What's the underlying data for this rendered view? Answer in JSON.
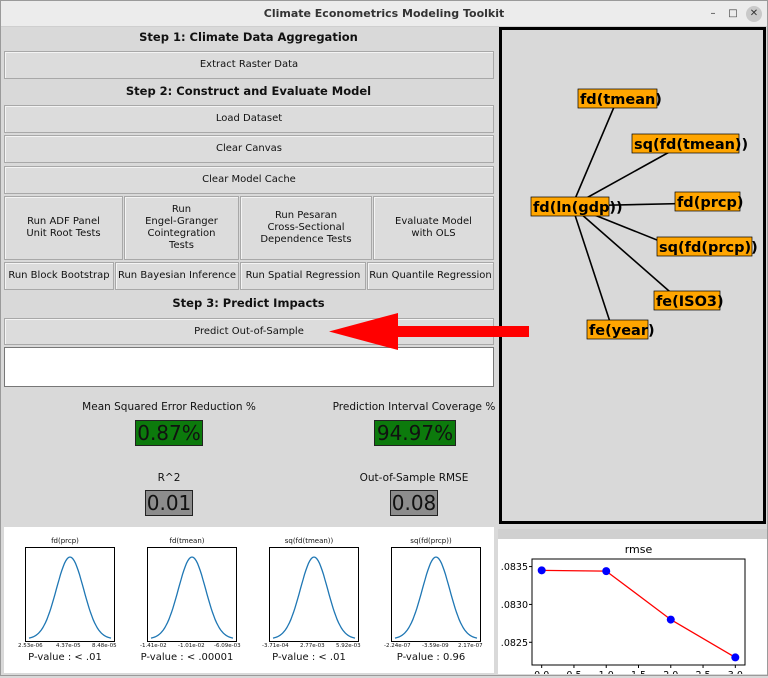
{
  "window": {
    "title": "Climate Econometrics Modeling Toolkit",
    "min_icon": "minimize-icon",
    "max_icon": "maximize-icon",
    "close_icon": "close-icon"
  },
  "step1": {
    "header": "Step 1: Climate Data Aggregation",
    "extract_button": "Extract Raster Data"
  },
  "step2": {
    "header": "Step 2: Construct and Evaluate Model",
    "load_button": "Load Dataset",
    "clear_canvas_button": "Clear Canvas",
    "clear_cache_button": "Clear Model Cache",
    "adf_button": "Run ADF Panel\nUnit Root Tests",
    "engle_button": "Run\nEngel-Granger\nCointegration\nTests",
    "pesaran_button": "Run Pesaran\nCross-Sectional\nDependence Tests",
    "evaluate_button": "Evaluate Model\nwith OLS",
    "bootstrap_button": "Run Block Bootstrap",
    "bayesian_button": "Run Bayesian Inference",
    "spatial_button": "Run Spatial Regression",
    "quantile_button": "Run Quantile Regression"
  },
  "step3": {
    "header": "Step 3: Predict Impacts",
    "predict_button": "Predict Out-of-Sample",
    "input_value": ""
  },
  "metrics": {
    "mse_label": "Mean Squared Error Reduction %",
    "mse_value": "0.87%",
    "pic_label": "Prediction Interval Coverage %",
    "pic_value": "94.97%",
    "r2_label": "R^2",
    "r2_value": "0.01",
    "rmse_label": "Out-of-Sample RMSE",
    "rmse_value": "0.08"
  },
  "colors": {
    "node_fill": "#ffa500",
    "good_metric": "#0c7a0c",
    "neutral_metric": "#8c8c8c",
    "arrow": "#ff0000",
    "curve": "#1f77b4",
    "rmse_line": "#ff0000",
    "rmse_marker": "#0000ff"
  },
  "graph": {
    "center": "fd(ln(gdp))",
    "nodes": [
      "fd(tmean)",
      "sq(fd(tmean))",
      "fd(prcp)",
      "sq(fd(prcp))",
      "fe(ISO3)",
      "fe(year)"
    ]
  },
  "distributions": [
    {
      "title": "fd(prcp)",
      "ticks": [
        "2.53e-06",
        "4.37e-05",
        "8.48e-05"
      ],
      "pvalue": "P-value : < .01"
    },
    {
      "title": "fd(tmean)",
      "ticks": [
        "-1.41e-02",
        "-1.01e-02",
        "-6.09e-03"
      ],
      "pvalue": "P-value : < .00001"
    },
    {
      "title": "sq(fd(tmean))",
      "ticks": [
        "-3.71e-04",
        "2.77e-03",
        "5.92e-03"
      ],
      "pvalue": "P-value : < .01"
    },
    {
      "title": "sq(fd(prcp))",
      "ticks": [
        "-2.24e-07",
        "-3.59e-09",
        "2.17e-07"
      ],
      "pvalue": "P-value : 0.96"
    }
  ],
  "chart_data": {
    "type": "line",
    "title": "rmse",
    "xlabel": "",
    "ylabel": "",
    "x": [
      0,
      1,
      2,
      3
    ],
    "series": [
      {
        "values": [
          0.08345,
          0.08344,
          0.0828,
          0.0823
        ]
      }
    ],
    "xticks": [
      "0.0",
      "0.5",
      "1.0",
      "1.5",
      "2.0",
      "2.5",
      "3.0"
    ],
    "yticks": [
      ".0835",
      ".0830",
      ".0825"
    ],
    "xlim": [
      -0.15,
      3.15
    ],
    "ylim": [
      0.0822,
      0.0836
    ],
    "grid": false
  }
}
